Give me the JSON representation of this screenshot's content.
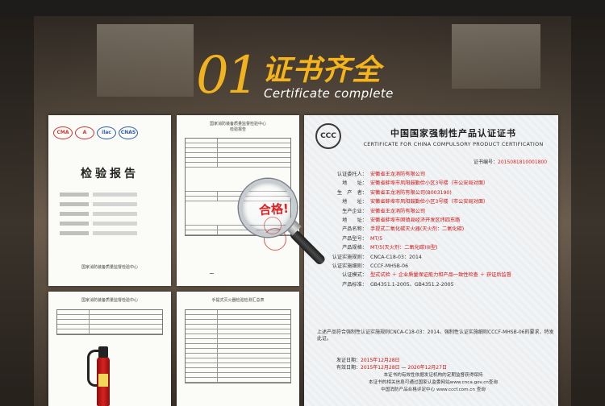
{
  "heading": {
    "number": "01",
    "title": "证书齐全",
    "subtitle": "Certificate complete"
  },
  "doc1": {
    "logos": [
      "CMA",
      "A",
      "ilac",
      "CNAS"
    ],
    "title": "检验报告",
    "footer": "国家消防装备质量监督检验中心"
  },
  "doc2": {
    "header": "国家消防装备质量监督检验中心",
    "subheader": "检验报告"
  },
  "doc3": {
    "header": "国家消防装备质量监督检验中心"
  },
  "doc4": {
    "header": "手提式灭火器检验检测汇总表"
  },
  "magnifier": {
    "label": "合格!"
  },
  "certificate": {
    "logo": "CCC",
    "title_cn": "中国国家强制性产品认证证书",
    "title_en": "CERTIFICATE FOR CHINA COMPULSORY PRODUCT CERTIFICATION",
    "number_label": "证书编号：",
    "number": "2015081810001800",
    "fields": [
      {
        "label": "认证委托人：",
        "value": "安徽省王龙消防有限公司",
        "red": true
      },
      {
        "label": "地　　址：",
        "value": "安徽省蚌埠市凤阳鼓勤俭小区3号楼（市公安局对面）",
        "red": true
      },
      {
        "label": "生　产　者：",
        "value": "安徽省王龙消防有限公司(B003190)",
        "red": true
      },
      {
        "label": "地　　址：",
        "value": "安徽省蚌埠市凤阳鼓勤俭小区3号楼（市公安局对面）",
        "red": true
      },
      {
        "label": "生产企业：",
        "value": "安徽省王龙消防有限公司",
        "red": true
      },
      {
        "label": "地　　址：",
        "value": "安徽省蚌埠市固镇县经济开发区纬四东路",
        "red": true
      },
      {
        "label": "产品名称：",
        "value": "手提式二氧化碳灭火器(灭火剂：二氧化碳)",
        "red": true
      },
      {
        "label": "产品型号：",
        "value": "MT/5",
        "red": true
      },
      {
        "label": "产品规格：",
        "value": "MT/5(灭火剂：二氧化碳)(Ⅱ型)",
        "red": true
      },
      {
        "label": "认证实施规则：",
        "value": "CNCA-C18-03：2014",
        "red": false
      },
      {
        "label": "认证实施细则：",
        "value": "CCCF-MHSB-06",
        "red": false
      },
      {
        "label": "认证模式：",
        "value": "型式试验 ＋ 企业质量保证能力和产品一致性检查 ＋ 获证后监督",
        "red": true
      },
      {
        "label": "产品标准：",
        "value": "GB4351.1-2005、GB4351.2-2005",
        "red": false
      }
    ],
    "description": "上述产品符合强制性认证实施规则CNCA-C18-03：2014、强制性认证实施细则CCCF-MHSB-06的要求，特发此证。",
    "issue_date_label": "发证日期：",
    "issue_date": "2015年12月28日",
    "validity_label": "有效日期：",
    "valid_from": "2015年12月28日",
    "valid_to": "2020年12月27日",
    "footer_line1": "本证书的有效性依据发证机构的定期监督获得保持",
    "footer_line2": "本证书的相关信息可通过国家认监委网站www.cnca.gov.cn查询",
    "footer_line3": "中国消防产品合格评定中心 www.cccf.com.cn 查询"
  }
}
